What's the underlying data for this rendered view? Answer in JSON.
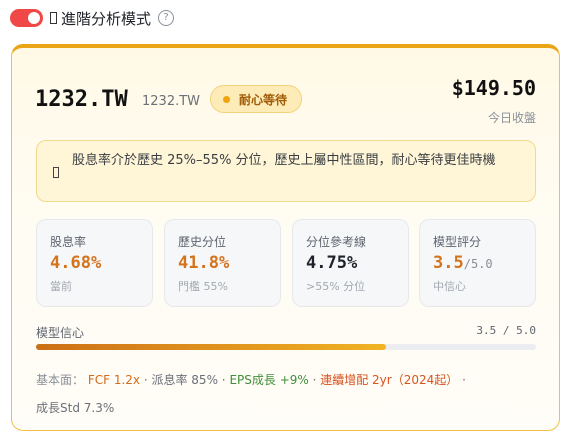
{
  "mode": {
    "label": "進階分析模式",
    "toggle_on": true,
    "help_icon": "?"
  },
  "header": {
    "ticker": "1232.TW",
    "ticker_sub": "1232.TW",
    "badge": "耐心等待",
    "price": "$149.50",
    "price_label": "今日收盤"
  },
  "note": {
    "text": "股息率介於歷史 25%–55% 分位，歷史上屬中性區間，耐心等待更佳時機"
  },
  "stats": [
    {
      "label": "股息率",
      "value": "4.68%",
      "sub": "當前"
    },
    {
      "label": "歷史分位",
      "value": "41.8%",
      "sub": "門檻 55%"
    },
    {
      "label": "分位參考線",
      "value": "4.75%",
      "sub": ">55% 分位"
    },
    {
      "label": "模型評分",
      "value": "3.5",
      "value_suffix": "/5.0",
      "sub": "中信心"
    }
  ],
  "confidence": {
    "label": "模型信心",
    "value": "3.5 / 5.0",
    "fraction": 0.7
  },
  "fundamentals": {
    "prefix": "基本面：",
    "fcf": "FCF 1.2x",
    "sep1": " · ",
    "payout": "派息率 85%",
    "sep2": " · ",
    "eps": "EPS成長 +9%",
    "sep3": " · ",
    "streak": "連續增配 2yr（2024起）",
    "sep4": " · ",
    "growth_std": "成長Std 7.3%"
  },
  "colors": {
    "accent": "#eba416",
    "toggle": "#f04747",
    "value_orange": "#d4731b",
    "eps_green": "#3f8f3a"
  }
}
